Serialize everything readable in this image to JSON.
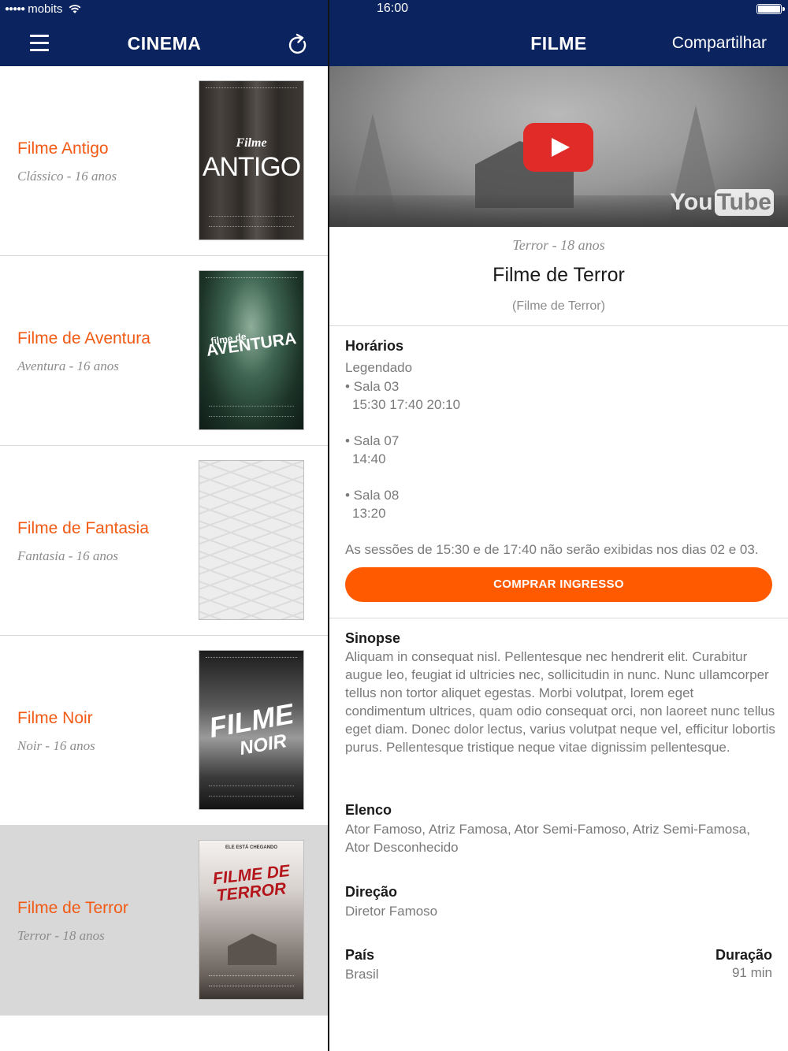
{
  "status_bar": {
    "carrier": "mobits",
    "time": "16:00"
  },
  "nav_left": {
    "title": "CINEMA",
    "menu_icon": "menu-icon",
    "refresh_icon": "refresh-icon"
  },
  "nav_right": {
    "title": "FILME",
    "share_label": "Compartilhar"
  },
  "movies": [
    {
      "title": "Filme Antigo",
      "subtitle": "Clássico - 16 anos",
      "poster_line1": "Filme",
      "poster_line2": "ANTIGO",
      "selected": false
    },
    {
      "title": "Filme de Aventura",
      "subtitle": "Aventura - 16 anos",
      "poster_line1": "filme de",
      "poster_line2": "AVENTURA",
      "selected": false
    },
    {
      "title": "Filme de Fantasia",
      "subtitle": "Fantasia - 16 anos",
      "poster_line1": "",
      "poster_line2": "",
      "selected": false
    },
    {
      "title": "Filme Noir",
      "subtitle": "Noir - 16 anos",
      "poster_line1": "FILME",
      "poster_line2": "NOIR",
      "selected": false
    },
    {
      "title": "Filme de Terror",
      "subtitle": "Terror - 18 anos",
      "poster_top": "ELE ESTÁ CHEGANDO",
      "poster_line1": "FILME DE",
      "poster_line2": "TERROR",
      "selected": true
    }
  ],
  "detail": {
    "video": {
      "logo_you": "You",
      "logo_tube": "Tube"
    },
    "genre": "Terror - 18 anos",
    "title": "Filme de Terror",
    "original_title": "(Filme de Terror)",
    "schedule": {
      "heading": "Horários",
      "format": "Legendado",
      "rooms": [
        {
          "room": "• Sala 03",
          "times": "15:30 17:40 20:10"
        },
        {
          "room": "• Sala 07",
          "times": "14:40"
        },
        {
          "room": "• Sala 08",
          "times": "13:20"
        }
      ],
      "note": "As sessões de 15:30 e de 17:40 não serão exibidas nos dias 02 e 03."
    },
    "buy_label": "COMPRAR INGRESSO",
    "synopsis_heading": "Sinopse",
    "synopsis": "Aliquam in consequat nisl. Pellentesque nec hendrerit elit. Curabitur augue leo, feugiat id ultricies nec, sollicitudin in nunc. Nunc ullamcorper tellus non tortor aliquet egestas. Morbi volutpat, lorem eget condimentum ultrices, quam odio consequat orci, non laoreet nunc tellus eget diam. Donec dolor lectus, varius volutpat neque vel, efficitur lobortis purus. Pellentesque tristique neque vitae dignissim pellentesque.",
    "cast_heading": "Elenco",
    "cast": "Ator Famoso, Atriz Famosa, Ator Semi-Famoso, Atriz Semi-Famosa, Ator Desconhecido",
    "director_heading": "Direção",
    "director": "Diretor Famoso",
    "country_heading": "País",
    "country": "Brasil",
    "duration_heading": "Duração",
    "duration": "91 min"
  },
  "colors": {
    "nav": "#0b2460",
    "accent": "#f25a14",
    "button": "#ff5a00",
    "selected_row": "#d8d8d8"
  }
}
